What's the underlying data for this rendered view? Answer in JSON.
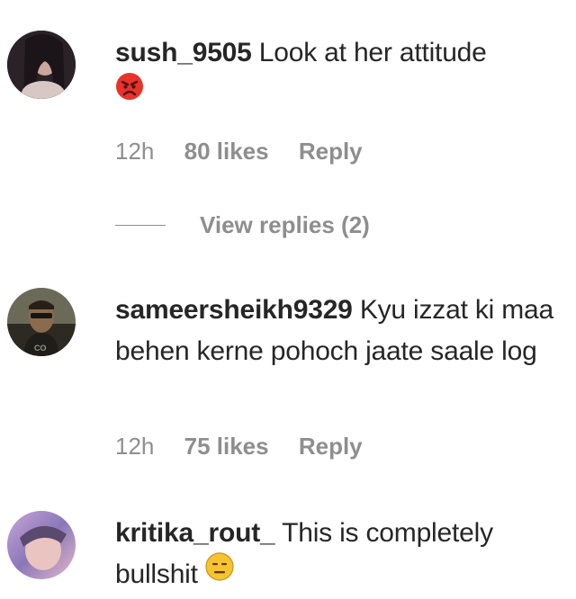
{
  "comments": [
    {
      "username": "sush_9505",
      "text": "Look at her attitude",
      "emoji": "angry-face",
      "time": "12h",
      "likes": "80 likes",
      "reply": "Reply"
    },
    {
      "username": "sameersheikh9329",
      "text": "Kyu izzat ki maa behen kerne pohoch jaate saale log",
      "time": "12h",
      "likes": "75 likes",
      "reply": "Reply"
    },
    {
      "username": "kritika_rout_",
      "text": "This is completely bullshit",
      "emoji": "expressionless-face"
    }
  ],
  "view_replies": "View replies (2)",
  "colors": {
    "text": "#262626",
    "muted": "#8e8e8e",
    "angry_emoji": "#e8332a",
    "neutral_emoji": "#f7c331"
  }
}
